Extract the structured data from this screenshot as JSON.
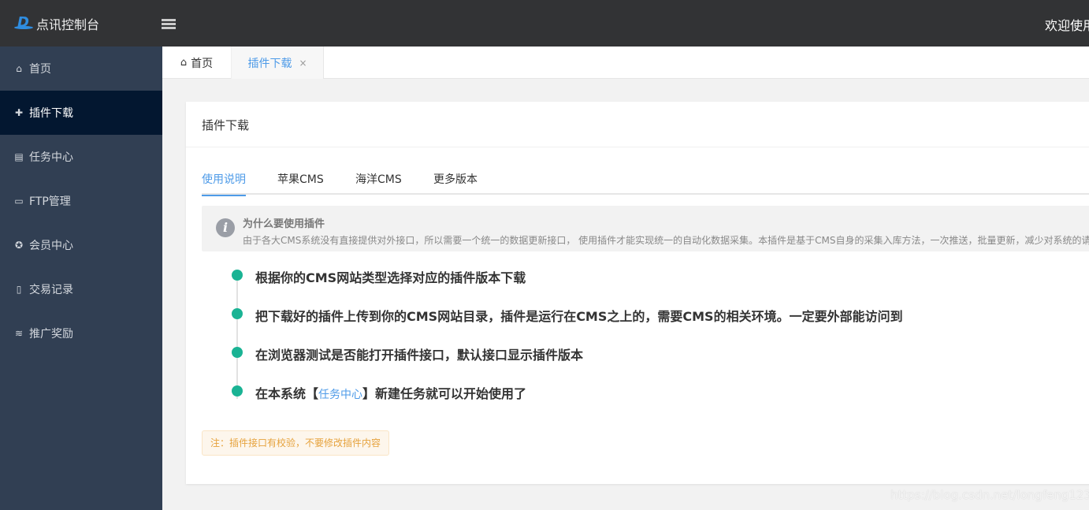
{
  "header": {
    "brand": "点讯控制台",
    "welcome": "欢迎使用",
    "icons": {
      "logo": "logo-d-icon",
      "toggle": "menu-fold-icon"
    }
  },
  "sidebar": {
    "items": [
      {
        "label": "首页",
        "icon": "home-icon",
        "glyph": "⌂"
      },
      {
        "label": "插件下载",
        "icon": "puzzle-icon",
        "glyph": "✚",
        "active": true
      },
      {
        "label": "任务中心",
        "icon": "clipboard-icon",
        "glyph": "▤"
      },
      {
        "label": "FTP管理",
        "icon": "hdd-icon",
        "glyph": "▭"
      },
      {
        "label": "会员中心",
        "icon": "award-icon",
        "glyph": "✪"
      },
      {
        "label": "交易记录",
        "icon": "book-icon",
        "glyph": "▯"
      },
      {
        "label": "推广奖励",
        "icon": "coins-icon",
        "glyph": "≋"
      }
    ]
  },
  "tabs": {
    "home": "首页",
    "current": "插件下载",
    "close": "×"
  },
  "card": {
    "title": "插件下载",
    "subtabs": [
      "使用说明",
      "苹果CMS",
      "海洋CMS",
      "更多版本"
    ],
    "info": {
      "title": "为什么要使用插件",
      "text": "由于各大CMS系统没有直接提供对外接口，所以需要一个统一的数据更新接口， 使用插件才能实现统一的自动化数据采集。本插件是基于CMS自身的采集入库方法，一次推送，批量更新，减少对系统的请"
    },
    "steps": [
      "根据你的CMS网站类型选择对应的插件版本下载",
      "把下载好的插件上传到你的CMS网站目录，插件是运行在CMS之上的，需要CMS的相关环境。一定要外部能访问到",
      "在浏览器测试是否能打开插件接口，默认接口显示插件版本"
    ],
    "step4": {
      "before": "在本系统【",
      "link": "任务中心",
      "after": "】新建任务就可以开始使用了"
    },
    "note": "注：插件接口有校验，不要修改插件内容"
  },
  "watermark": "https://blog.csdn.net/longfeng1234",
  "colors": {
    "accent": "#4e9be8",
    "timeline": "#1ab394",
    "header": "#323335",
    "sidebar": "#313f53",
    "sidebar_active": "#031730"
  }
}
